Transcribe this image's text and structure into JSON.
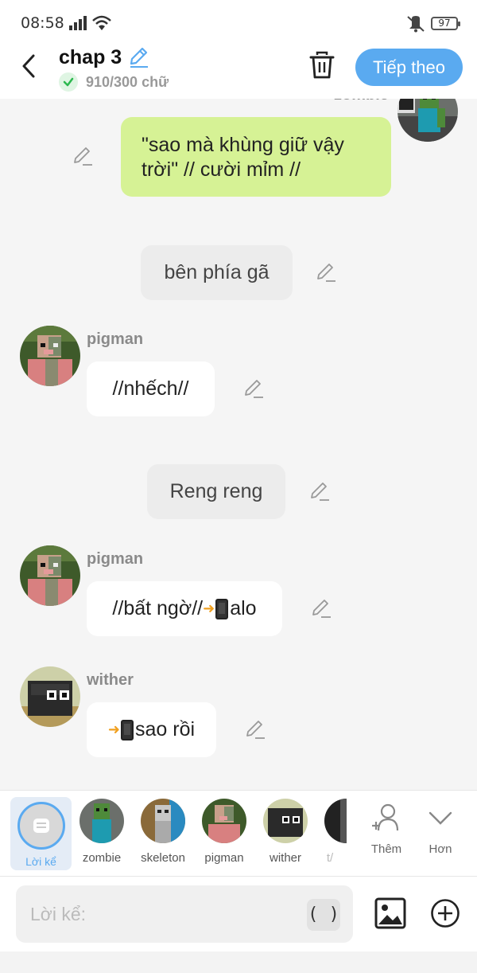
{
  "status_bar": {
    "time": "08:58",
    "battery": "97"
  },
  "header": {
    "title": "chap 3",
    "word_count": "910/300 chữ",
    "next_label": "Tiếp theo"
  },
  "chat": {
    "top_speaker": "zombie",
    "messages": [
      {
        "kind": "own",
        "speaker": "zombie",
        "text": "\"sao mà khùng giữ vậy trời\" // cười mỉm //"
      },
      {
        "kind": "narration",
        "text": "bên phía gã"
      },
      {
        "kind": "other",
        "speaker": "pigman",
        "text": "//nhếch//"
      },
      {
        "kind": "narration",
        "text": "Reng reng"
      },
      {
        "kind": "other",
        "speaker": "pigman",
        "text_before": "//bất ngờ//",
        "text_after": "alo"
      },
      {
        "kind": "other",
        "speaker": "wither",
        "text_after": "sao rồi"
      }
    ]
  },
  "character_bar": {
    "selected_label": "Lời kể",
    "characters": [
      "zombie",
      "skeleton",
      "pigman",
      "wither",
      "t/"
    ],
    "add_label": "Thêm",
    "more_label": "Hơn"
  },
  "input": {
    "placeholder": "Lời kể:",
    "paren_label": "( )"
  },
  "colors": {
    "accent": "#5aaaf0",
    "own_bubble": "#d6f295",
    "narration_bubble": "#ececec",
    "background": "#f5f5f5"
  },
  "icons": [
    "signal-icon",
    "wifi-icon",
    "mute-icon",
    "battery-icon",
    "back-icon",
    "edit-icon",
    "check-icon",
    "trash-icon",
    "pencil-icon",
    "phone-icon",
    "add-person-icon",
    "chevron-down-icon",
    "image-icon",
    "plus-circle-icon"
  ]
}
